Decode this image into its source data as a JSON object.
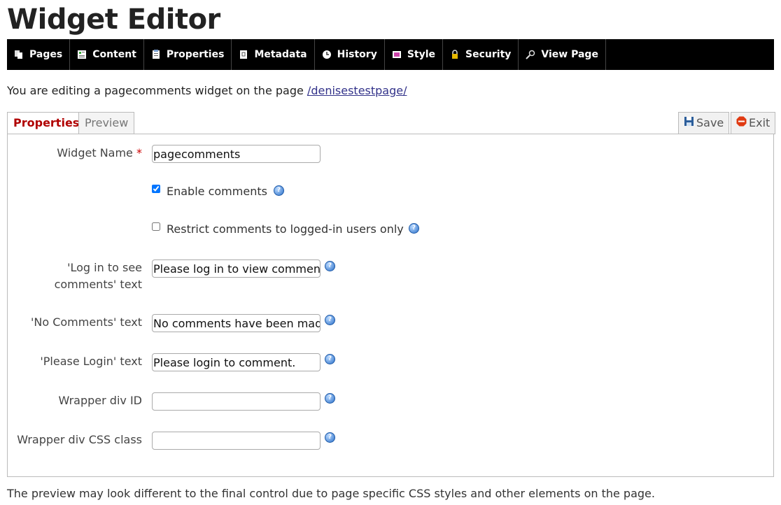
{
  "title": "Widget Editor",
  "nav": [
    {
      "label": "Pages",
      "icon": "pages-icon"
    },
    {
      "label": "Content",
      "icon": "content-icon"
    },
    {
      "label": "Properties",
      "icon": "properties-icon"
    },
    {
      "label": "Metadata",
      "icon": "metadata-icon"
    },
    {
      "label": "History",
      "icon": "history-icon"
    },
    {
      "label": "Style",
      "icon": "style-icon"
    },
    {
      "label": "Security",
      "icon": "lock-icon"
    },
    {
      "label": "View Page",
      "icon": "magnifier-icon"
    }
  ],
  "intro": {
    "text": "You are editing a pagecomments widget on the page ",
    "link": "/denisestestpage/"
  },
  "tabs": {
    "properties": "Properties",
    "preview": "Preview",
    "save": "Save",
    "exit": "Exit"
  },
  "form": {
    "widget_name_label": "Widget Name",
    "required_mark": "*",
    "widget_name_value": "pagecomments",
    "enable_comments_label": "Enable comments",
    "enable_comments_checked": true,
    "restrict_label": "Restrict comments to logged-in users only",
    "restrict_checked": false,
    "login_to_see_label": "'Log in to see comments' text",
    "login_to_see_value": "Please log in to view comments.",
    "no_comments_label": "'No Comments' text",
    "no_comments_value": "No comments have been made.",
    "please_login_label": "'Please Login' text",
    "please_login_value": "Please login to comment.",
    "wrapper_id_label": "Wrapper div ID",
    "wrapper_id_value": "",
    "wrapper_css_label": "Wrapper div CSS class",
    "wrapper_css_value": ""
  },
  "footer": "The preview may look different to the final control due to page specific CSS styles and other elements on the page.",
  "colors": {
    "navbar": "#000000",
    "active_tab_text": "#b00000",
    "required": "#cc0000",
    "link": "#33338a"
  }
}
